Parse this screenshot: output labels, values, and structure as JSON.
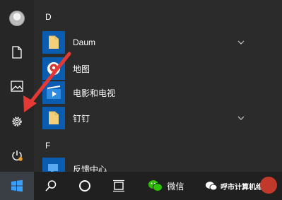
{
  "start_menu": {
    "groups": [
      {
        "letter": "D",
        "apps": [
          {
            "label": "Daum",
            "icon": "folder-icon",
            "expandable": true
          },
          {
            "label": "地图",
            "icon": "maps-icon",
            "expandable": false
          },
          {
            "label": "电影和电视",
            "icon": "movies-tv-icon",
            "expandable": false
          },
          {
            "label": "钉钉",
            "icon": "folder-icon",
            "expandable": true
          }
        ]
      },
      {
        "letter": "F",
        "apps": [
          {
            "label": "反馈中心",
            "icon": "feedback-hub-icon",
            "expandable": false
          }
        ]
      }
    ],
    "rail": [
      "user-avatar",
      "documents-icon",
      "pictures-icon",
      "settings-icon",
      "power-icon"
    ]
  },
  "taskbar": {
    "items": [
      "windows-start-icon",
      "search-icon",
      "cortana-icon",
      "task-view-icon"
    ],
    "wechat_label": "微信",
    "watermark_label": "呼市计算机维护"
  },
  "colors": {
    "accent": "#0a5cb0",
    "folder": "#f3d17a",
    "arrow": "#e53935",
    "taskbar": "#202020",
    "menu": "#2b2b2b"
  }
}
